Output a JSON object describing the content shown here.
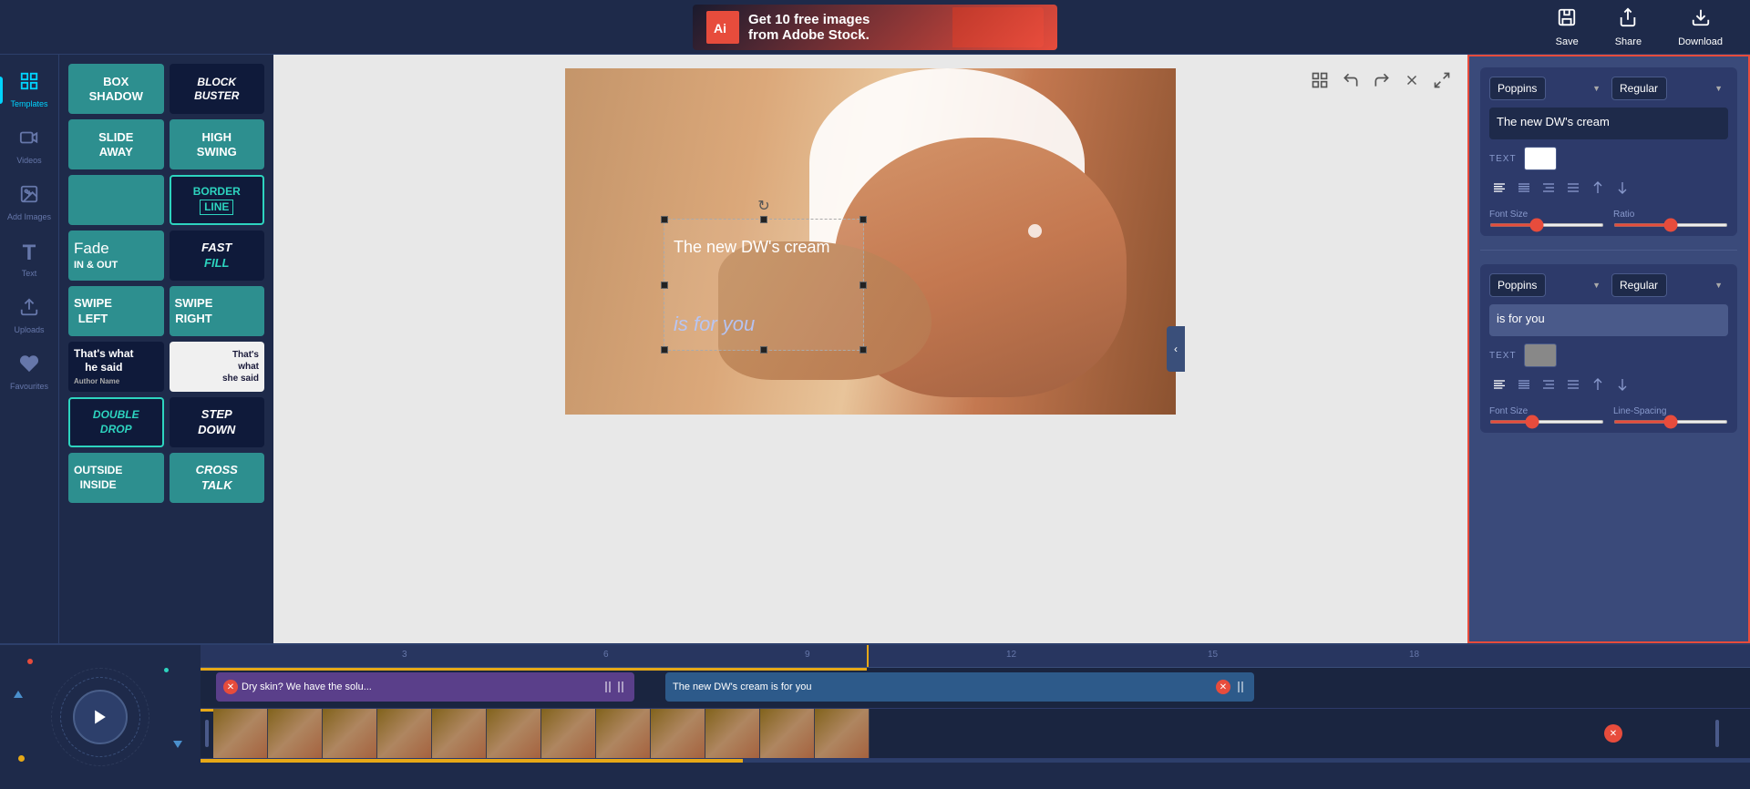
{
  "topbar": {
    "adobe_logo": "Ai",
    "adobe_title": "Get 10 free images",
    "adobe_subtitle": "from Adobe Stock.",
    "save_label": "Save",
    "share_label": "Share",
    "download_label": "Download"
  },
  "sidebar": {
    "items": [
      {
        "id": "templates",
        "label": "Templates",
        "icon": "⊞"
      },
      {
        "id": "videos",
        "label": "Videos",
        "icon": "▶"
      },
      {
        "id": "add-images",
        "label": "Add Images",
        "icon": "🖼"
      },
      {
        "id": "text",
        "label": "Text",
        "icon": "T"
      },
      {
        "id": "uploads",
        "label": "Uploads",
        "icon": "⬆"
      },
      {
        "id": "favourites",
        "label": "Favourites",
        "icon": "♥"
      }
    ]
  },
  "templates": {
    "items": [
      {
        "id": "box-shadow",
        "label": "BOX\nSHADOW",
        "style": "tpl-1"
      },
      {
        "id": "block-buster",
        "label": "BLOCK BUSTER",
        "style": "tpl-2"
      },
      {
        "id": "slide-away",
        "label": "SLIDE\nAWAY",
        "style": "tpl-3"
      },
      {
        "id": "high-swing",
        "label": "HIGH\nSWING",
        "style": "tpl-4"
      },
      {
        "id": "color-block",
        "label": "",
        "style": "tpl-5 color-only"
      },
      {
        "id": "border-line",
        "label": "BORDER\nLINE",
        "style": "tpl-6"
      },
      {
        "id": "fast-fill",
        "label": "FAST\nFILL",
        "style": "tpl-12"
      },
      {
        "id": "fade-in-out",
        "label": "Fade\nIN & OUT",
        "style": "tpl-7"
      },
      {
        "id": "swipe-left",
        "label": "SWIPE\nLEFT",
        "style": "tpl-8"
      },
      {
        "id": "swipe-right",
        "label": "SWIPE\nRIGHT",
        "style": "tpl-9"
      },
      {
        "id": "thats-what",
        "label": "That's what\nhe said",
        "style": "tpl-13"
      },
      {
        "id": "she-said",
        "label": "That's\nwhat\nshe said",
        "style": "tpl-14"
      },
      {
        "id": "double-drop",
        "label": "DOUBLE\nDROP",
        "style": "tpl-11"
      },
      {
        "id": "step-down",
        "label": "STEP\nDOWN",
        "style": "tpl-12"
      },
      {
        "id": "outside-inside",
        "label": "OUTSIDE\nINSIDE",
        "style": "tpl-8"
      },
      {
        "id": "cross-talk",
        "label": "CROSS\nTALK",
        "style": "tpl-12"
      }
    ]
  },
  "canvas": {
    "text1": "The new DW's cream",
    "text2": "is for you",
    "rotate_icon": "↻"
  },
  "right_panel": {
    "section1": {
      "font": "Poppins",
      "font_style": "Regular",
      "text_value": "The new DW's cream",
      "text_label": "Text",
      "color": "#ffffff",
      "font_size_label": "Font Size",
      "ratio_label": "Ratio",
      "font_size_value": 40,
      "ratio_value": 50,
      "align_options": [
        "left",
        "center",
        "right",
        "justify",
        "top",
        "bottom"
      ]
    },
    "section2": {
      "font": "Poppins",
      "font_style": "Regular",
      "text_value": "is for you",
      "text_label": "Text",
      "color": "#888888",
      "font_size_label": "Font Size",
      "line_spacing_label": "Line-Spacing",
      "font_size_value": 35,
      "line_spacing_value": 50,
      "align_options": [
        "left",
        "center",
        "right",
        "justify",
        "top",
        "bottom"
      ]
    }
  },
  "timeline": {
    "ruler_marks": [
      "3",
      "6",
      "9",
      "12",
      "15",
      "18"
    ],
    "playhead_position": "43%",
    "tracks": [
      {
        "id": "caption1",
        "clips": [
          {
            "text": "Dry skin? We have the solu...",
            "start": "0%",
            "width": "28%",
            "type": "purple"
          },
          {
            "text": "The new DW's cream is for you",
            "start": "31%",
            "width": "38%",
            "type": "blue"
          }
        ]
      }
    ],
    "progress_fill": "35%"
  }
}
